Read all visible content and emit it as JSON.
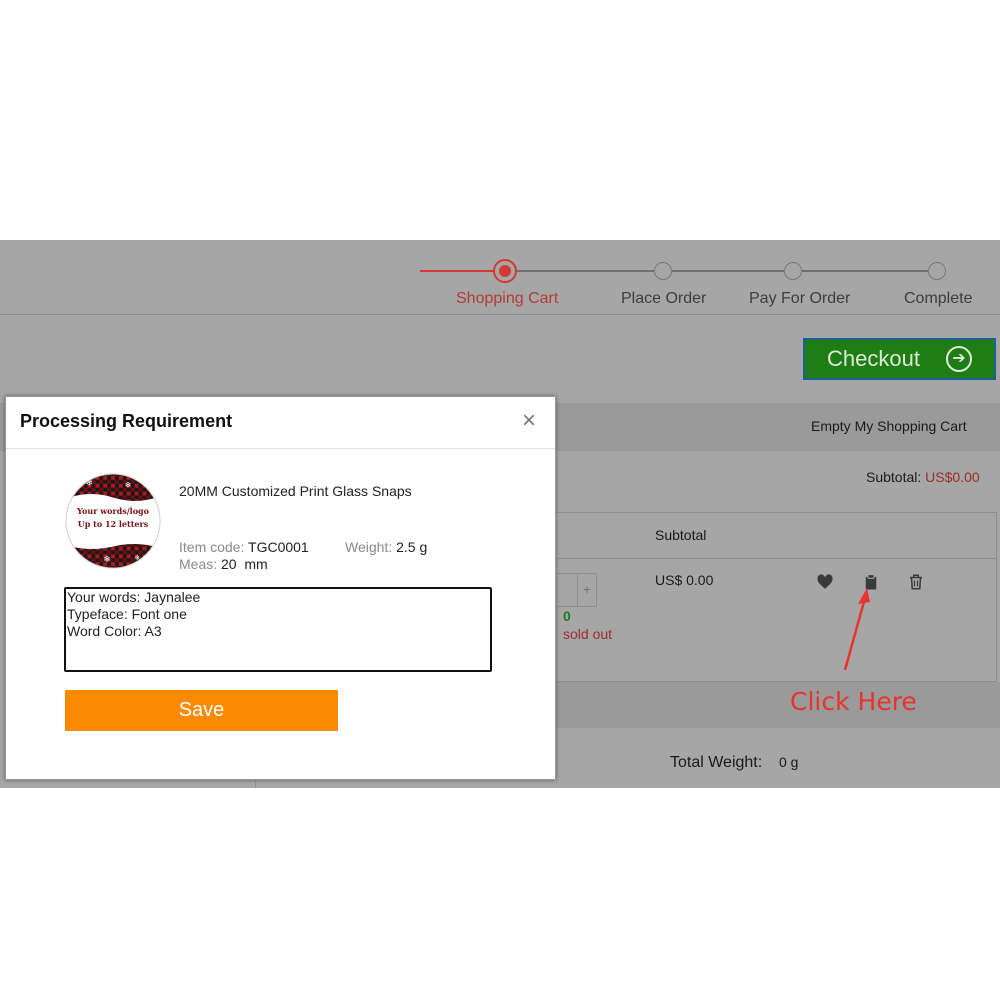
{
  "steps": [
    {
      "label": "Shopping Cart",
      "active": true
    },
    {
      "label": "Place Order",
      "active": false
    },
    {
      "label": "Pay For Order",
      "active": false
    },
    {
      "label": "Complete",
      "active": false
    }
  ],
  "cart": {
    "checkout_label": "Checkout",
    "empty_cart_label": "Empty My Shopping Cart",
    "subtotal_label": "Subtotal:",
    "subtotal_value": "US$0.00",
    "column_subtotal": "Subtotal",
    "item_price": "US$ 0.00",
    "qty_plus": "+",
    "stock_count": "0",
    "sold_out": "sold out",
    "total_weight_label": "Total Weight:",
    "total_weight_value": "0 g"
  },
  "annotation": {
    "text": "Click Here",
    "color": "#e8342c"
  },
  "modal": {
    "title": "Processing Requirement",
    "close": "×",
    "product_name": "20MM Customized Print Glass Snaps",
    "image_text_line1": "Your words/logo",
    "image_text_line2": "Up to 12 letters",
    "item_code_label": "Item code:",
    "item_code": "TGC0001",
    "weight_label": "Weight:",
    "weight": "2.5 g",
    "meas_label": "Meas:",
    "meas": "20  mm",
    "requirement_lines": [
      "Your words: Jaynalee",
      "Typeface: Font one",
      "Word Color: A3"
    ],
    "save_label": "Save"
  },
  "colors": {
    "accent_red": "#d43a33",
    "checkout_green": "#1e7d14",
    "save_orange": "#fb8a00"
  }
}
